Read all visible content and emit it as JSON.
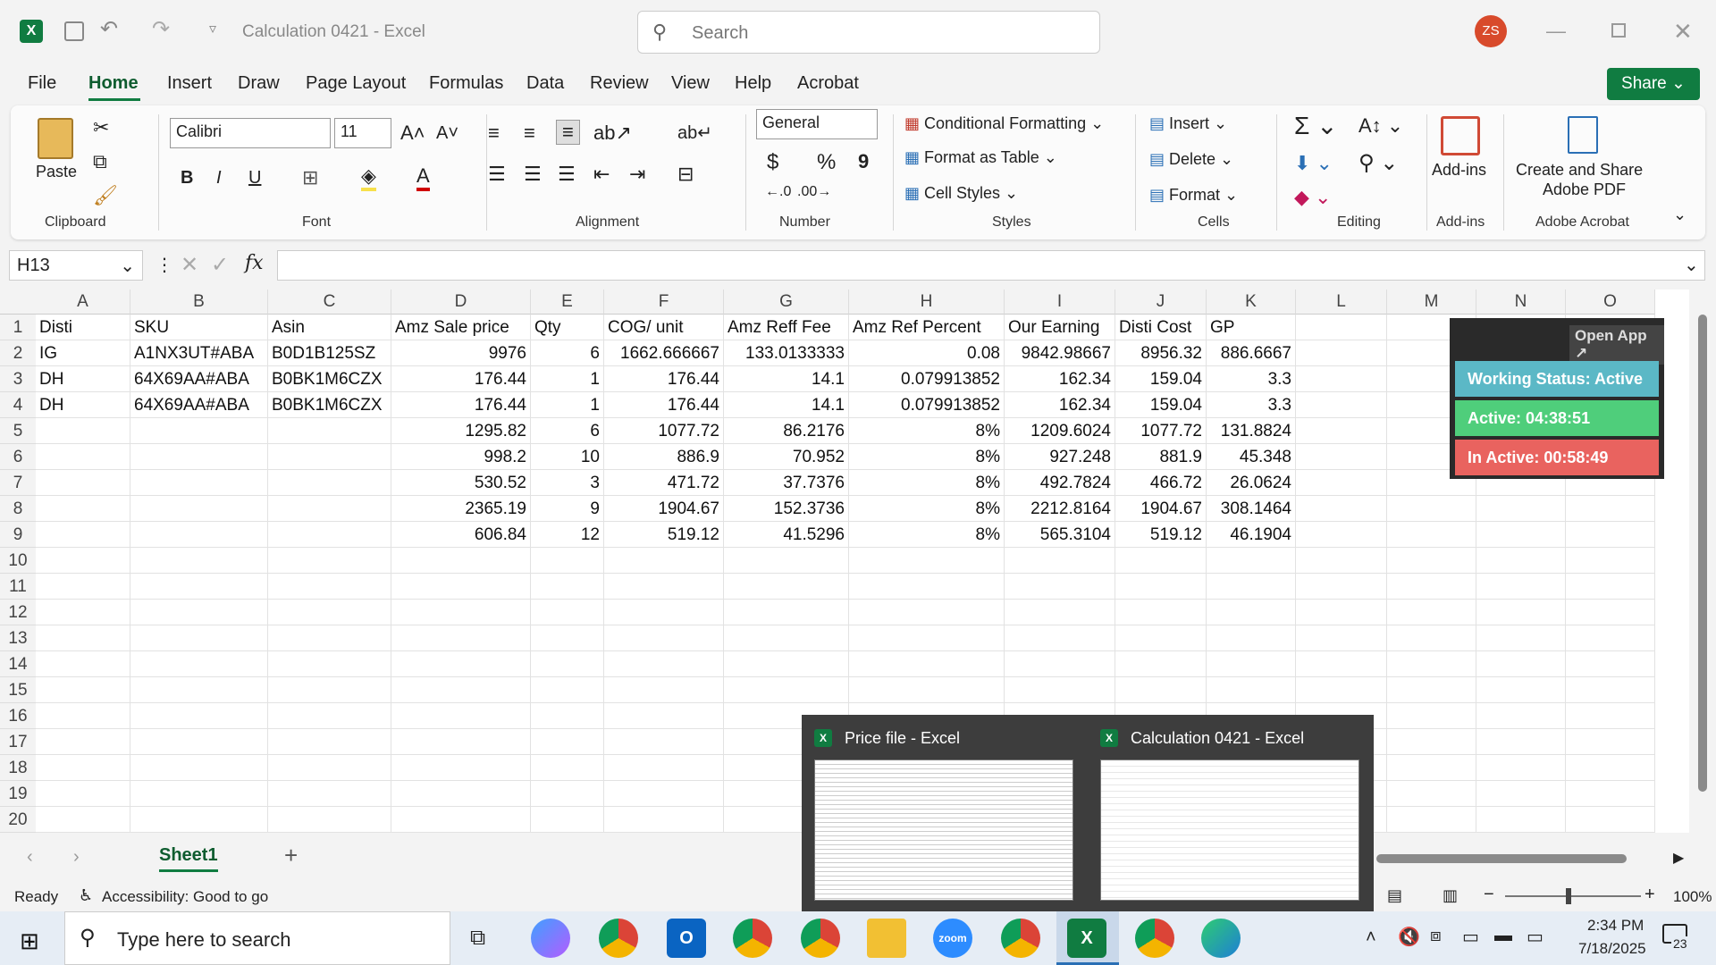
{
  "window": {
    "title": "Calculation 0421  -  Excel",
    "search_placeholder": "Search",
    "avatar": "ZS"
  },
  "tabs": [
    "File",
    "Home",
    "Insert",
    "Draw",
    "Page Layout",
    "Formulas",
    "Data",
    "Review",
    "View",
    "Help",
    "Acrobat"
  ],
  "share": "Share",
  "ribbon": {
    "clipboard": {
      "paste": "Paste",
      "label": "Clipboard"
    },
    "font": {
      "name": "Calibri",
      "size": "11",
      "label": "Font",
      "bold": "B",
      "italic": "I",
      "underline": "U"
    },
    "alignment": {
      "label": "Alignment"
    },
    "number": {
      "format": "General",
      "label": "Number",
      "currency": "$",
      "percent": "%",
      "comma": "9"
    },
    "styles": {
      "conditional": "Conditional Formatting",
      "table": "Format as Table",
      "cell": "Cell Styles",
      "label": "Styles"
    },
    "cells": {
      "insert": "Insert",
      "delete": "Delete",
      "format": "Format",
      "label": "Cells"
    },
    "editing": {
      "label": "Editing"
    },
    "addins": {
      "btn": "Add-ins",
      "label": "Add-ins"
    },
    "acrobat": {
      "btn1": "Create and Share",
      "btn2": "Adobe PDF",
      "label": "Adobe Acrobat"
    }
  },
  "formula_bar": {
    "namebox": "H13",
    "fx": "fx",
    "value": ""
  },
  "columns": [
    "A",
    "B",
    "C",
    "D",
    "E",
    "F",
    "G",
    "H",
    "I",
    "J",
    "K",
    "L",
    "M",
    "N",
    "O"
  ],
  "rows": [
    [
      "Disti",
      "SKU",
      "Asin",
      "Amz Sale price",
      "Qty",
      "COG/ unit",
      "Amz Reff Fee",
      "Amz Ref Percent",
      "Our Earning",
      "Disti Cost",
      "GP"
    ],
    [
      "IG",
      "A1NX3UT#ABA",
      "B0D1B125SZ",
      "9976",
      "6",
      "1662.666667",
      "133.0133333",
      "0.08",
      "9842.98667",
      "8956.32",
      "886.6667"
    ],
    [
      "DH",
      "64X69AA#ABA",
      "B0BK1M6CZX",
      "176.44",
      "1",
      "176.44",
      "14.1",
      "0.079913852",
      "162.34",
      "159.04",
      "3.3"
    ],
    [
      "DH",
      "64X69AA#ABA",
      "B0BK1M6CZX",
      "176.44",
      "1",
      "176.44",
      "14.1",
      "0.079913852",
      "162.34",
      "159.04",
      "3.3"
    ],
    [
      "",
      "",
      "",
      "1295.82",
      "6",
      "1077.72",
      "86.2176",
      "8%",
      "1209.6024",
      "1077.72",
      "131.8824"
    ],
    [
      "",
      "",
      "",
      "998.2",
      "10",
      "886.9",
      "70.952",
      "8%",
      "927.248",
      "881.9",
      "45.348"
    ],
    [
      "",
      "",
      "",
      "530.52",
      "3",
      "471.72",
      "37.7376",
      "8%",
      "492.7824",
      "466.72",
      "26.0624"
    ],
    [
      "",
      "",
      "",
      "2365.19",
      "9",
      "1904.67",
      "152.3736",
      "8%",
      "2212.8164",
      "1904.67",
      "308.1464"
    ],
    [
      "",
      "",
      "",
      "606.84",
      "12",
      "519.12",
      "41.5296",
      "8%",
      "565.3104",
      "519.12",
      "46.1904"
    ]
  ],
  "row_numbers": [
    "1",
    "2",
    "3",
    "4",
    "5",
    "6",
    "7",
    "8",
    "9",
    "10",
    "11",
    "12",
    "13",
    "14",
    "15",
    "16",
    "17",
    "18",
    "19",
    "20"
  ],
  "tracker": {
    "open": "Open App ↗",
    "status": "Working Status: Active",
    "active": "Active: 04:38:51",
    "inactive": "In Active: 00:58:49"
  },
  "sheet": {
    "name": "Sheet1"
  },
  "status": {
    "ready": "Ready",
    "accessibility": "Accessibility: Good to go",
    "zoom": "100%"
  },
  "preview": {
    "left_title": "Price file - Excel",
    "right_title": "Calculation 0421 - Excel"
  },
  "taskbar": {
    "search": "Type here to search",
    "time": "2:34 PM",
    "date": "7/18/2025",
    "notif": "23",
    "zoom": "zoom"
  },
  "colors": {
    "excel_green": "#107c41",
    "tracker_blue": "#5bb8c6",
    "tracker_green": "#4fce7b",
    "tracker_red": "#e9635f"
  }
}
